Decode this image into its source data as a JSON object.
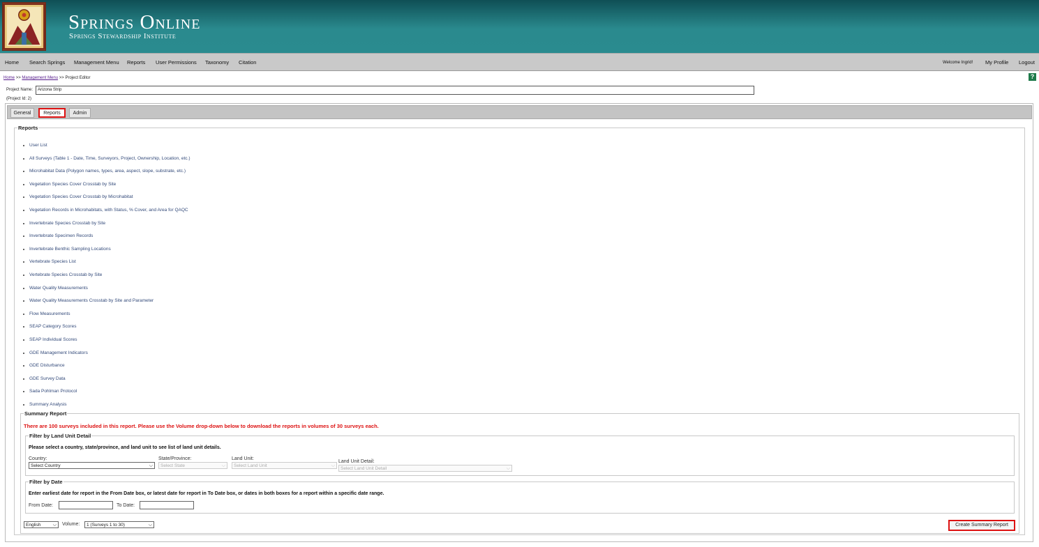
{
  "header": {
    "logo": "springs-stewardship-logo",
    "title": "Springs Online",
    "subtitle": "Springs Stewardship Institute"
  },
  "nav": {
    "items": [
      "Home",
      "Search Springs",
      "Management Menu",
      "Reports",
      "User Permissions",
      "Taxonomy",
      "Citation"
    ],
    "welcome": "Welcome Ingrid!",
    "profile": "My Profile",
    "logout": "Logout"
  },
  "breadcrumb": {
    "home": "Home",
    "sep1": ">>",
    "management": "Management Menu",
    "sep2": ">>",
    "current": "Project Editor"
  },
  "help_label": "?",
  "project": {
    "name_label": "Project Name:",
    "name_value": "Arizona Strip",
    "id_text": "(Project Id: 2)"
  },
  "tabs": [
    {
      "label": "General",
      "active": false
    },
    {
      "label": "Reports",
      "active": true
    },
    {
      "label": "Admin",
      "active": false
    }
  ],
  "reports": {
    "legend": "Reports",
    "items": [
      "User List",
      "All Surveys (Table 1 - Date, Time, Surveyors, Project, Ownership, Location, etc.)",
      "Microhabitat Data (Polygon names, types, area, aspect, slope, substrate, etc.)",
      "Vegetation Species Cover Crosstab by Site",
      "Vegetation Species Cover Crosstab by Microhabitat",
      "Vegetation Records in Microhabitats, with Status, % Cover, and Area for QAQC",
      "Invertebrate Species Crosstab by Site",
      "Invertebrate Specimen Records",
      "Invertebrate Benthic Sampling Locations",
      "Vertebrate Species List",
      "Vertebrate Species Crosstab by Site",
      "Water Quality Measurements",
      "Water Quality Measurements Crosstab by Site and Parameter",
      "Flow Measurements",
      "SEAP Category Scores",
      "SEAP Individual Scores",
      "GDE Management Indicators",
      "GDE Disturbance",
      "GDE Survey Data",
      "Sada Pohlman Protocol",
      "Summary Analysis"
    ]
  },
  "summary": {
    "legend": "Summary Report",
    "warning": "There are 100 surveys included in this report. Please use the Volume drop-down below to download the reports in volumes of 30 surveys each.",
    "land_unit": {
      "legend": "Filter by Land Unit Detail",
      "instructions": "Please select a country, state/province, and land unit to see list of land unit details.",
      "country_label": "Country:",
      "country_value": "Select Country",
      "state_label": "State/Province:",
      "state_value": "Select State",
      "unit_label": "Land Unit:",
      "unit_value": "Select Land Unit",
      "detail_label": "Land Unit Detail:",
      "detail_value": "Select Land Unit Detail"
    },
    "date": {
      "legend": "Filter by Date",
      "instructions": "Enter earliest date for report in the From Date box, or latest date for report in To Date box, or dates in both boxes for a report within a specific date range.",
      "from_label": "From Date:",
      "to_label": "To Date:"
    },
    "language_value": "English",
    "volume_label": "Volume:",
    "volume_value": "1 (Surveys 1 to 30)",
    "create_button": "Create Summary Report"
  }
}
